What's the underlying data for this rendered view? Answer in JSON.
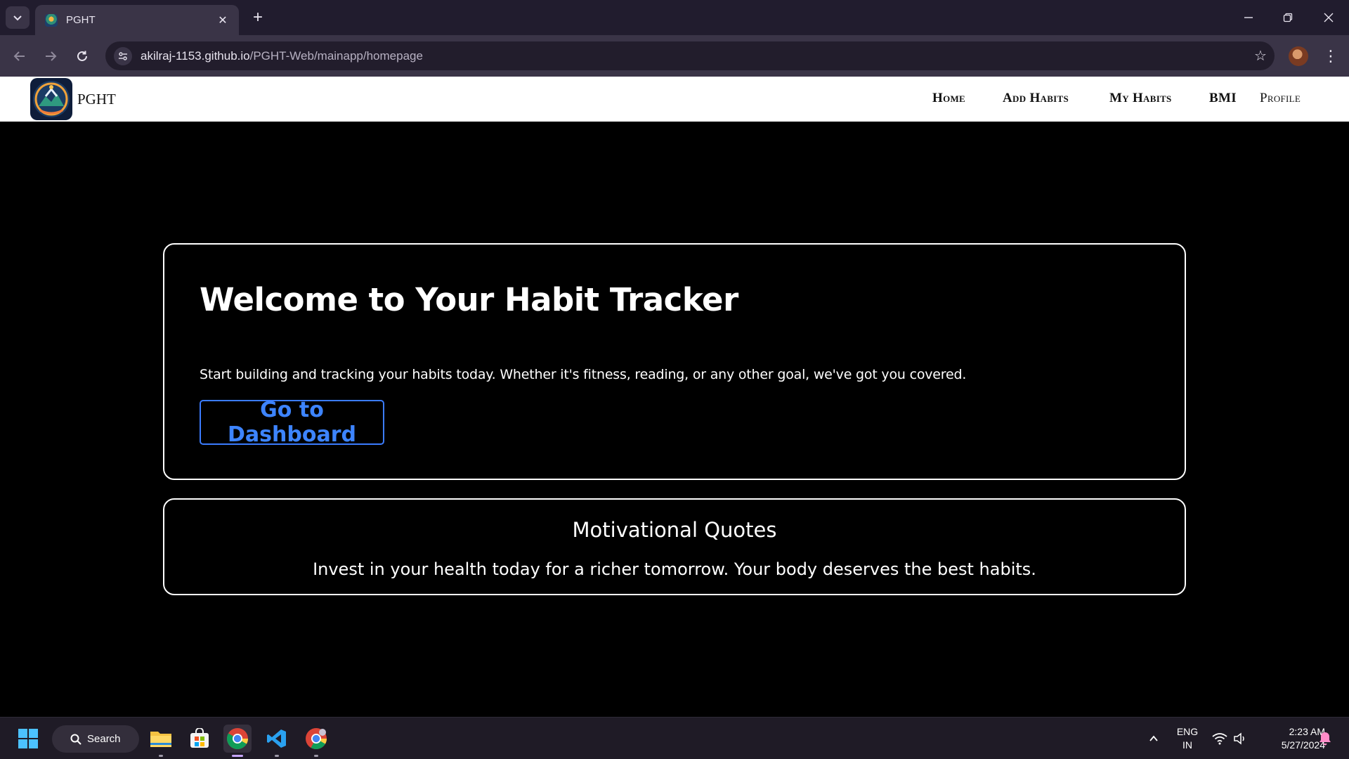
{
  "browser": {
    "tab_title": "PGHT",
    "url_host": "akilraj-1153.github.io",
    "url_path": "/PGHT-Web/mainapp/homepage"
  },
  "site": {
    "brand": "PGHT",
    "nav": [
      "Home",
      "Add Habits",
      "My Habits",
      "BMI",
      "Profile"
    ]
  },
  "welcome": {
    "heading": "Welcome to Your Habit Tracker",
    "description": "Start building and tracking your habits today. Whether it's fitness, reading, or any other goal, we've got you covered.",
    "button_label": "Go to Dashboard"
  },
  "quotes": {
    "heading": "Motivational Quotes",
    "quote": "Invest in your health today for a richer tomorrow. Your body deserves the best habits."
  },
  "taskbar": {
    "search_label": "Search",
    "language": "ENG",
    "region": "IN",
    "time": "2:23 AM",
    "date": "5/27/2024"
  },
  "colors": {
    "accent_blue": "#3d84ff",
    "page_background": "#000000",
    "header_background": "#ffffff",
    "browser_frame": "#211c2e"
  }
}
